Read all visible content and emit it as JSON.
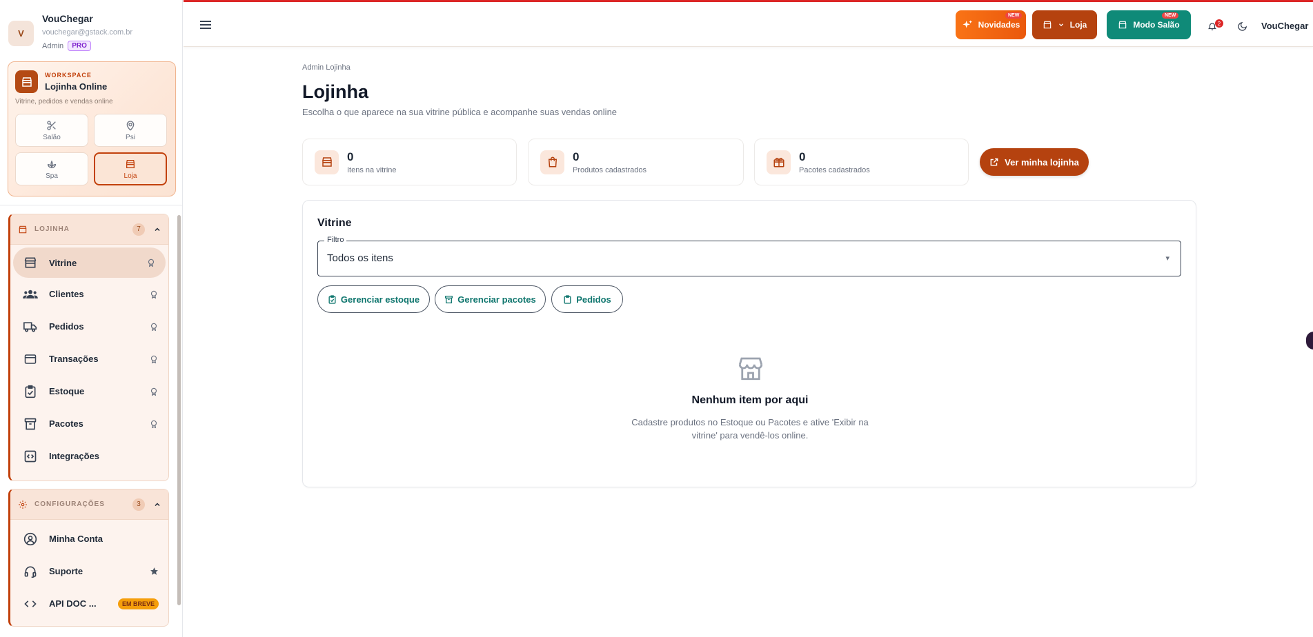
{
  "sidebar": {
    "profile": {
      "avatar_letter": "V",
      "name": "VouChegar",
      "email": "vouchegar@gstack.com.br",
      "role": "Admin",
      "plan_badge": "PRO"
    },
    "workspace": {
      "kicker": "WORKSPACE",
      "title": "Lojinha Online",
      "subtitle": "Vitrine, pedidos e vendas online",
      "modes": [
        {
          "label": "Salão",
          "icon": "scissors-icon"
        },
        {
          "label": "Psi",
          "icon": "map-pin-icon"
        },
        {
          "label": "Spa",
          "icon": "lotus-icon"
        },
        {
          "label": "Loja",
          "icon": "store-icon",
          "active": true
        }
      ]
    },
    "groups": [
      {
        "label": "LOJINHA",
        "count": "7",
        "items": [
          {
            "label": "Vitrine",
            "icon": "store-icon",
            "active": true,
            "trailing": "lock-icon"
          },
          {
            "label": "Clientes",
            "icon": "users-icon",
            "trailing": "lock-icon"
          },
          {
            "label": "Pedidos",
            "icon": "truck-icon",
            "trailing": "lock-icon"
          },
          {
            "label": "Transações",
            "icon": "credit-card-icon",
            "trailing": "lock-icon"
          },
          {
            "label": "Estoque",
            "icon": "clipboard-check-icon",
            "trailing": "lock-icon"
          },
          {
            "label": "Pacotes",
            "icon": "archive-icon",
            "trailing": "lock-icon"
          },
          {
            "label": "Integrações",
            "icon": "code-box-icon"
          }
        ]
      },
      {
        "label": "CONFIGURAÇÕES",
        "count": "3",
        "items": [
          {
            "label": "Minha Conta",
            "icon": "user-circle-icon"
          },
          {
            "label": "Suporte",
            "icon": "headset-icon",
            "trailing": "star-icon"
          },
          {
            "label": "API DOC ...",
            "icon": "code-icon",
            "badge": "EM BREVE"
          }
        ]
      }
    ]
  },
  "topbar": {
    "novidades": {
      "label": "Novidades",
      "badge": "NEW",
      "color": "#f97316"
    },
    "loja": {
      "label": "Loja",
      "color": "#b5420f"
    },
    "modo_salao": {
      "label": "Modo Salão",
      "badge": "NEW",
      "color": "#0f8a78"
    },
    "notifications_count": "2",
    "user_name": "VouChegar",
    "accent_line": "#dc2626"
  },
  "main": {
    "breadcrumb": "Admin Lojinha",
    "title": "Lojinha",
    "subtitle": "Escolha o que aparece na sua vitrine pública e acompanhe suas vendas online",
    "stats": [
      {
        "value": "0",
        "label": "Itens na vitrine",
        "icon": "store-icon"
      },
      {
        "value": "0",
        "label": "Produtos cadastrados",
        "icon": "shopping-bag-icon"
      },
      {
        "value": "0",
        "label": "Pacotes cadastrados",
        "icon": "gift-box-icon"
      }
    ],
    "cta_label": "Ver minha lojinha",
    "vitrine": {
      "title": "Vitrine",
      "filter_label": "Filtro",
      "filter_value": "Todos os itens",
      "actions": [
        {
          "label": "Gerenciar estoque",
          "icon": "clipboard-check-icon"
        },
        {
          "label": "Gerenciar pacotes",
          "icon": "archive-icon"
        },
        {
          "label": "Pedidos",
          "icon": "clipboard-icon"
        }
      ],
      "empty_title": "Nenhum item por aqui",
      "empty_text": "Cadastre produtos no Estoque ou Pacotes e ative 'Exibir na vitrine' para vendê-los online."
    }
  }
}
